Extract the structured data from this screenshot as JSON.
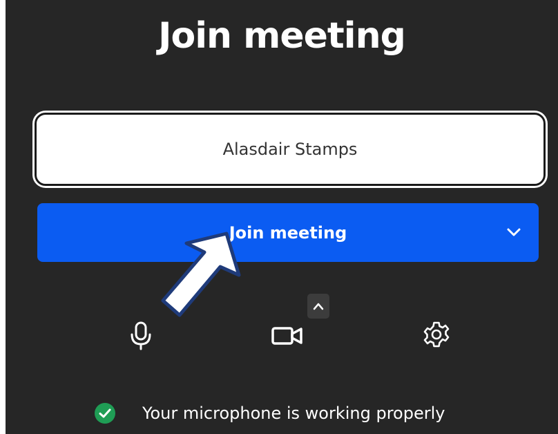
{
  "header": {
    "title": "Join meeting"
  },
  "name_field": {
    "value": "Alasdair Stamps"
  },
  "join_button": {
    "label": "Join meeting"
  },
  "controls": {
    "mic_icon": "microphone-icon",
    "camera_icon": "video-camera-icon",
    "camera_options_icon": "chevron-up-icon",
    "settings_icon": "gear-icon"
  },
  "status": {
    "text": "Your microphone is working properly",
    "icon": "check-circle-icon",
    "color": "#1f9d55"
  },
  "colors": {
    "background": "#262626",
    "accent": "#0b5cf2"
  }
}
